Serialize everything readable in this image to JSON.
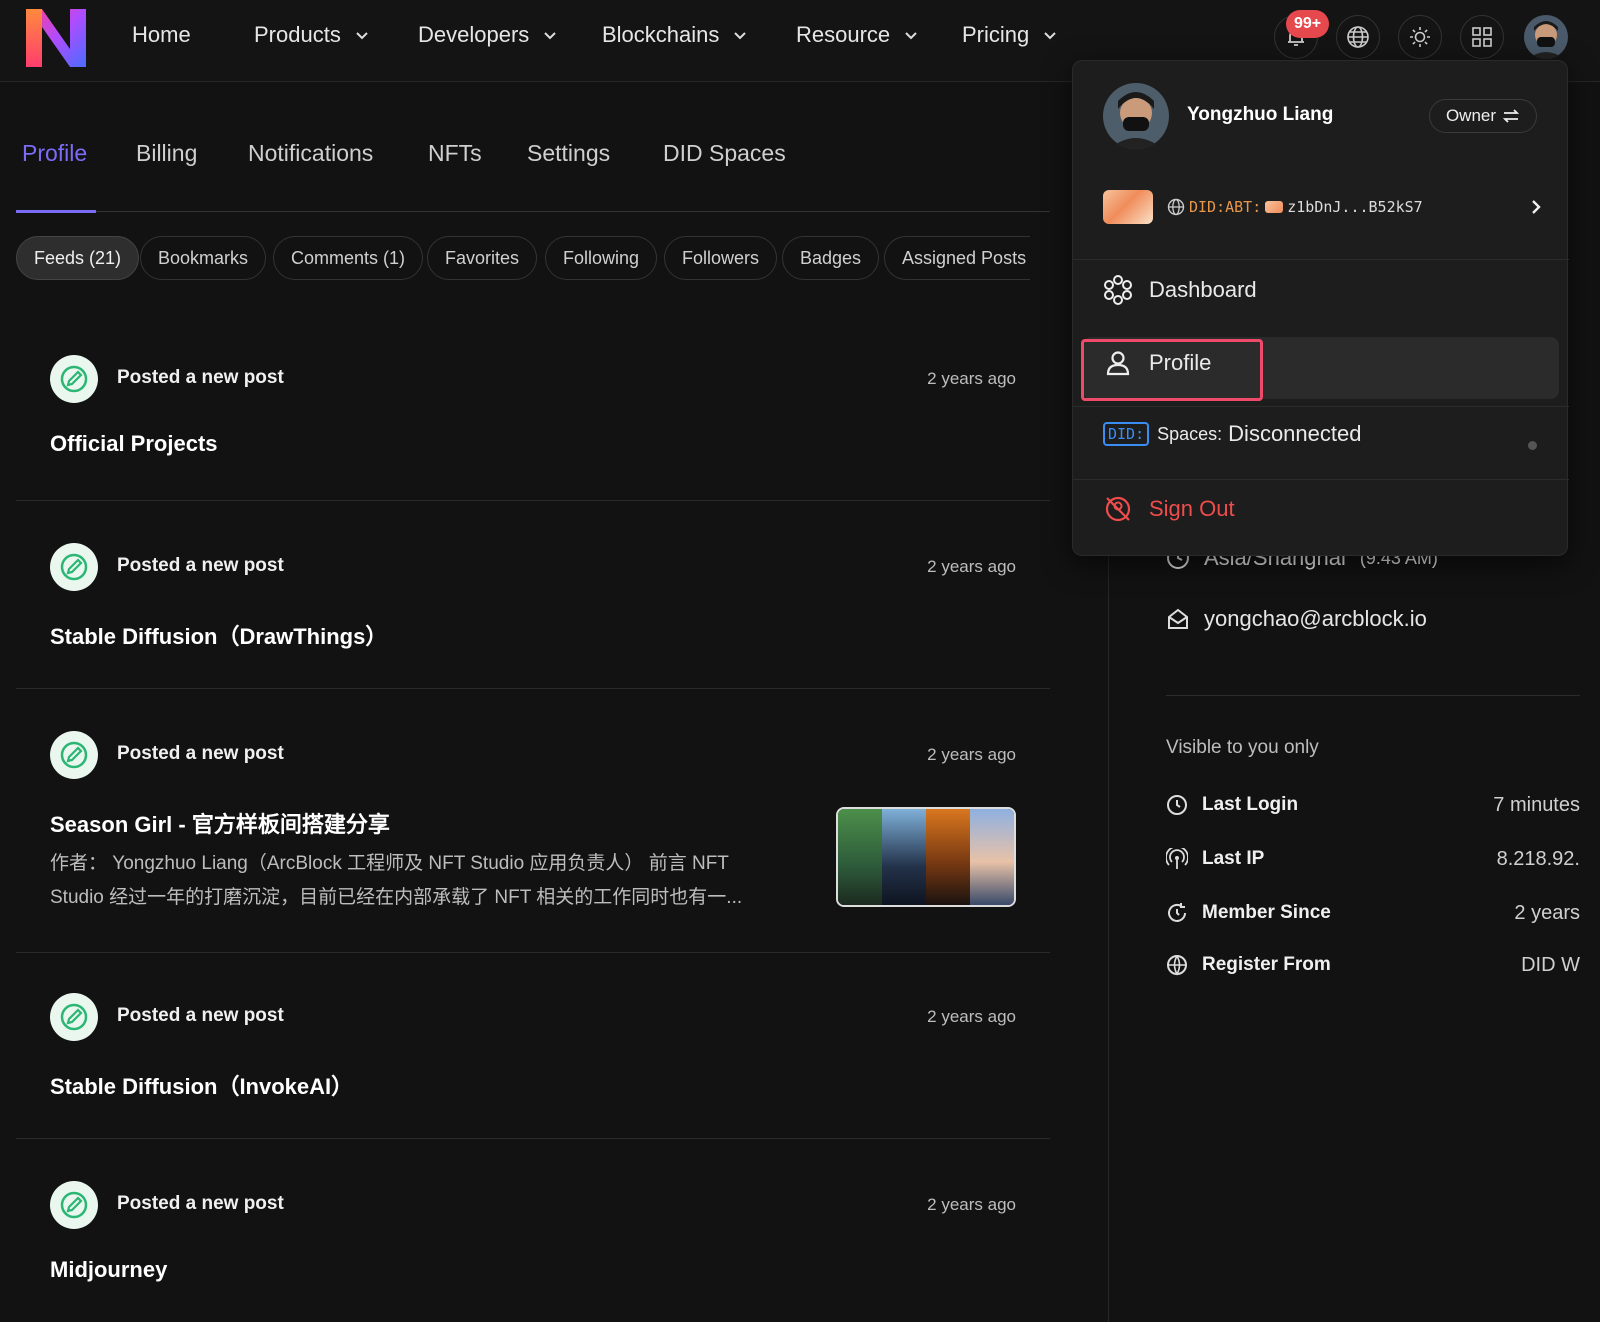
{
  "nav": {
    "home": "Home",
    "items": [
      "Products",
      "Developers",
      "Blockchains",
      "Resource",
      "Pricing"
    ],
    "notification_badge": "99+"
  },
  "tabs": [
    "Profile",
    "Billing",
    "Notifications",
    "NFTs",
    "Settings",
    "DID Spaces"
  ],
  "active_tab": "Profile",
  "chips": [
    "Feeds (21)",
    "Bookmarks",
    "Comments (1)",
    "Favorites",
    "Following",
    "Followers",
    "Badges",
    "Assigned Posts"
  ],
  "feed": [
    {
      "action": "Posted a new post",
      "time": "2 years ago",
      "title": "Official Projects"
    },
    {
      "action": "Posted a new post",
      "time": "2 years ago",
      "title": "Stable Diffusion（DrawThings）"
    },
    {
      "action": "Posted a new post",
      "time": "2 years ago",
      "title": "Season Girl - 官方样板间搭建分享",
      "excerpt_line1": "作者： Yongzhuo Liang（ArcBlock 工程师及 NFT Studio 应用负责人） 前言 NFT",
      "excerpt_line2": "Studio 经过一年的打磨沉淀，目前已经在内部承载了 NFT 相关的工作同时也有一..."
    },
    {
      "action": "Posted a new post",
      "time": "2 years ago",
      "title": "Stable Diffusion（InvokeAI）"
    },
    {
      "action": "Posted a new post",
      "time": "2 years ago",
      "title": "Midjourney"
    }
  ],
  "side": {
    "timezone": "Asia/Shanghai",
    "timezone_time": "(9:43 AM)",
    "email": "yongchao@arcblock.io",
    "visible_note": "Visible to you only",
    "stats": [
      {
        "label": "Last Login",
        "value": "7 minutes"
      },
      {
        "label": "Last IP",
        "value": "8.218.92."
      },
      {
        "label": "Member Since",
        "value": "2 years"
      },
      {
        "label": "Register From",
        "value": "DID W"
      }
    ]
  },
  "dropdown": {
    "name": "Yongzhuo Liang",
    "role": "Owner",
    "did_prefix": "DID:ABT:",
    "did_short": "z1bDnJ...B52kS7",
    "dashboard": "Dashboard",
    "profile": "Profile",
    "did_badge": "DID:",
    "spaces_label": "Spaces:",
    "spaces_status": "Disconnected",
    "signout": "Sign Out"
  },
  "colors": {
    "accent": "#7b6cf6",
    "danger": "#ef4c4c",
    "did_blue": "#3a8df3",
    "highlight_border": "#f04a6a"
  }
}
